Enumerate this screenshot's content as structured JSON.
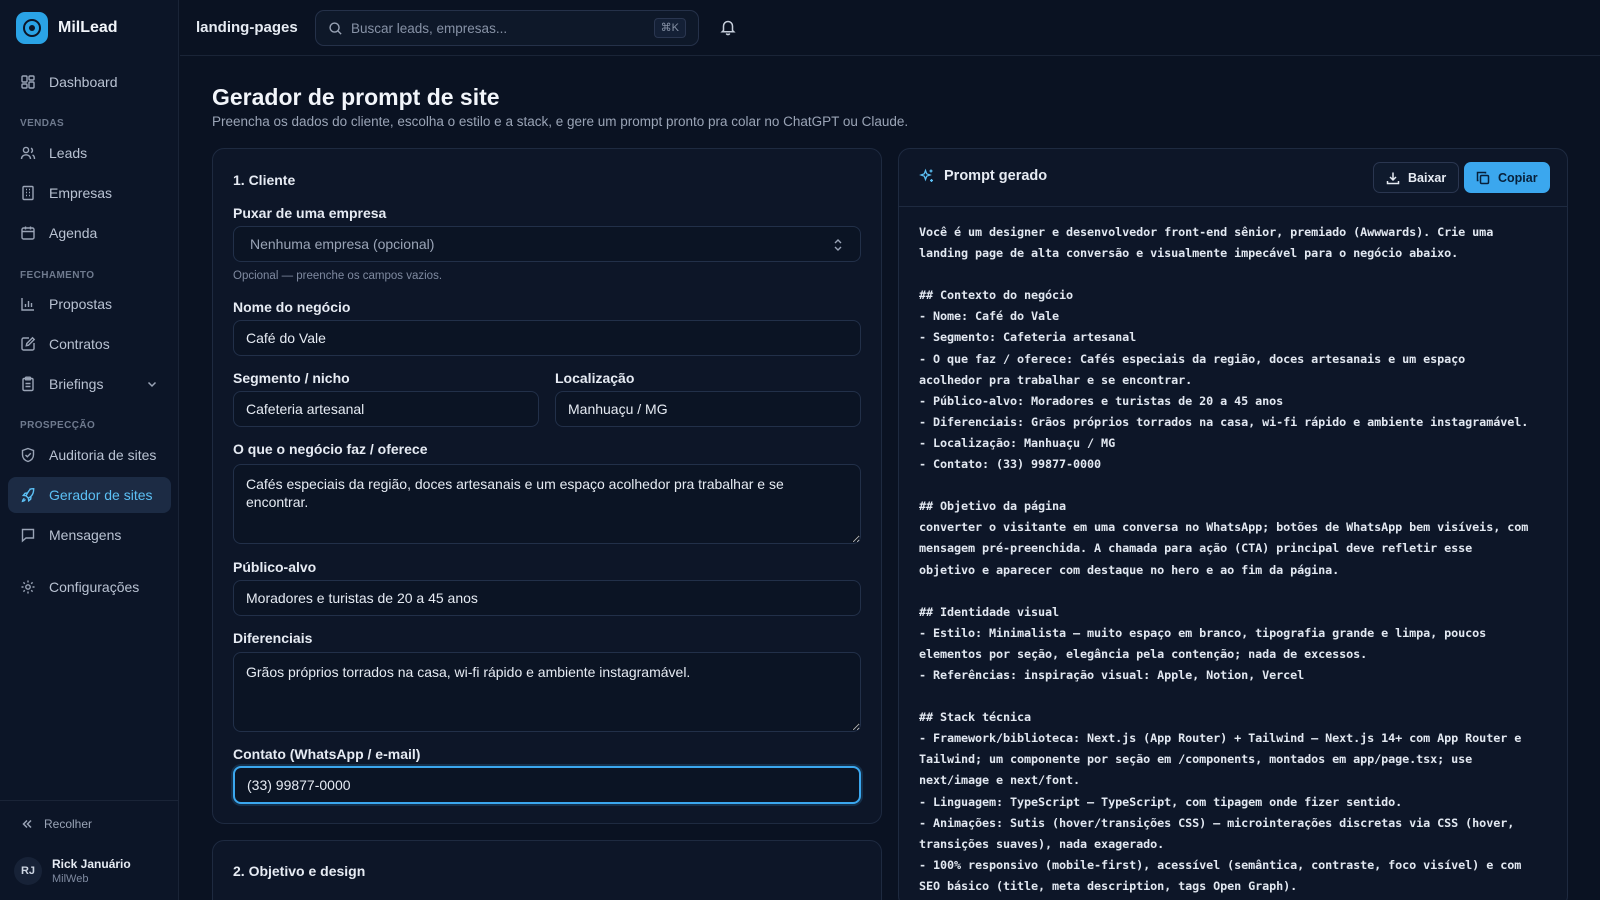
{
  "app": {
    "name": "MilLead"
  },
  "sidebar": {
    "dashboard": "Dashboard",
    "sections": {
      "vendas": "VENDAS",
      "fechamento": "FECHAMENTO",
      "prospeccao": "PROSPECÇÃO"
    },
    "items": {
      "leads": "Leads",
      "empresas": "Empresas",
      "agenda": "Agenda",
      "propostas": "Propostas",
      "contratos": "Contratos",
      "briefings": "Briefings",
      "auditoria": "Auditoria de sites",
      "gerador": "Gerador de sites",
      "mensagens": "Mensagens",
      "configuracoes": "Configurações"
    },
    "collapse": "Recolher",
    "user": {
      "initials": "RJ",
      "name": "Rick Januário",
      "org": "MilWeb"
    }
  },
  "topbar": {
    "breadcrumb": "landing-pages",
    "search_placeholder": "Buscar leads, empresas...",
    "shortcut": "⌘K"
  },
  "page": {
    "title": "Gerador de prompt de site",
    "subtitle": "Preencha os dados do cliente, escolha o estilo e a stack, e gere um prompt pronto pra colar no ChatGPT ou Claude."
  },
  "form": {
    "section1_title": "1. Cliente",
    "company_label": "Puxar de uma empresa",
    "company_value": "Nenhuma empresa (opcional)",
    "company_hint": "Opcional — preenche os campos vazios.",
    "name_label": "Nome do negócio",
    "name_value": "Café do Vale",
    "segment_label": "Segmento / nicho",
    "segment_value": "Cafeteria artesanal",
    "location_label": "Localização",
    "location_value": "Manhuaçu / MG",
    "offer_label": "O que o negócio faz / oferece",
    "offer_value": "Cafés especiais da região, doces artesanais e um espaço acolhedor pra trabalhar e se encontrar.",
    "audience_label": "Público-alvo",
    "audience_value": "Moradores e turistas de 20 a 45 anos",
    "differentials_label": "Diferenciais",
    "differentials_value": "Grãos próprios torrados na casa, wi-fi rápido e ambiente instagramável.",
    "contact_label": "Contato (WhatsApp / e-mail)",
    "contact_value": "(33) 99877-0000",
    "section2_title": "2. Objetivo e design"
  },
  "prompt": {
    "title": "Prompt gerado",
    "download_label": "Baixar",
    "copy_label": "Copiar",
    "lines": [
      "Você é um designer e desenvolvedor front-end sênior, premiado (Awwwards). Crie uma",
      "landing page de alta conversão e visualmente impecável para o negócio abaixo.",
      "",
      "## Contexto do negócio",
      "- Nome: Café do Vale",
      "- Segmento: Cafeteria artesanal",
      "- O que faz / oferece: Cafés especiais da região, doces artesanais e um espaço",
      "acolhedor pra trabalhar e se encontrar.",
      "- Público-alvo: Moradores e turistas de 20 a 45 anos",
      "- Diferenciais: Grãos próprios torrados na casa, wi-fi rápido e ambiente instagramável.",
      "- Localização: Manhuaçu / MG",
      "- Contato: (33) 99877-0000",
      "",
      "## Objetivo da página",
      "converter o visitante em uma conversa no WhatsApp; botões de WhatsApp bem visíveis, com",
      "mensagem pré-preenchida. A chamada para ação (CTA) principal deve refletir esse",
      "objetivo e aparecer com destaque no hero e ao fim da página.",
      "",
      "## Identidade visual",
      "- Estilo: Minimalista — muito espaço em branco, tipografia grande e limpa, poucos",
      "elementos por seção, elegância pela contenção; nada de excessos.",
      "- Referências: inspiração visual: Apple, Notion, Vercel",
      "",
      "## Stack técnica",
      "- Framework/biblioteca: Next.js (App Router) + Tailwind — Next.js 14+ com App Router e",
      "Tailwind; um componente por seção em /components, montados em app/page.tsx; use",
      "next/image e next/font.",
      "- Linguagem: TypeScript — TypeScript, com tipagem onde fizer sentido.",
      "- Animações: Sutis (hover/transições CSS) — microinterações discretas via CSS (hover,",
      "transições suaves), nada exagerado.",
      "- 100% responsivo (mobile-first), acessível (semântica, contraste, foco visível) e com",
      "SEO básico (title, meta description, tags Open Graph)."
    ]
  },
  "colors": {
    "accent": "#3ba7ee",
    "background": "#0a1222",
    "active_nav": "#1c2b44"
  }
}
